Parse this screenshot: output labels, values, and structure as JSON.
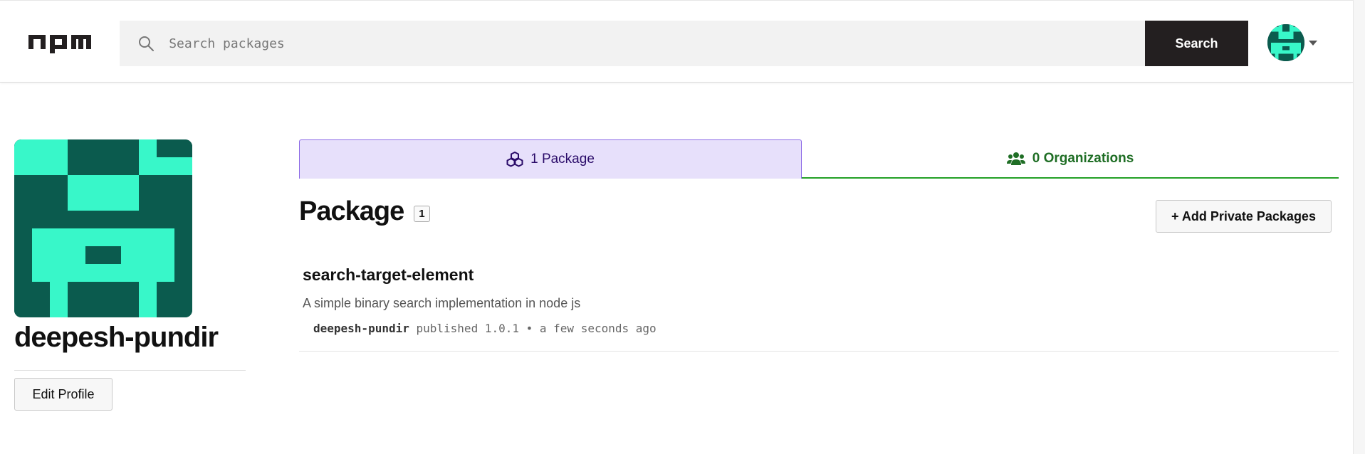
{
  "header": {
    "logo_text": "npm",
    "search_placeholder": "Search packages",
    "search_button": "Search",
    "user_menu_icon": "chevron-down-icon"
  },
  "colors": {
    "avatar_dark": "#0b5b4e",
    "avatar_light": "#38f7c9",
    "tab_active_bg": "#e7e0fb",
    "tab_active_border": "#8c6ae6",
    "tab_inactive_text": "#1f6e25",
    "tab_inactive_border": "#23a026",
    "search_button_bg": "#231f20"
  },
  "profile": {
    "username": "deepesh-pundir",
    "edit_button": "Edit Profile"
  },
  "tabs": [
    {
      "label": "1 Package",
      "icon": "cubes-icon",
      "active": true
    },
    {
      "label": "0 Organizations",
      "icon": "users-icon",
      "active": false
    }
  ],
  "packages_section": {
    "heading": "Package",
    "count": "1",
    "add_private_button": "+ Add Private Packages"
  },
  "packages": [
    {
      "name": "search-target-element",
      "description": "A simple binary search implementation in node js",
      "publisher": "deepesh-pundir",
      "meta_text": "published 1.0.1 • a few seconds ago"
    }
  ]
}
